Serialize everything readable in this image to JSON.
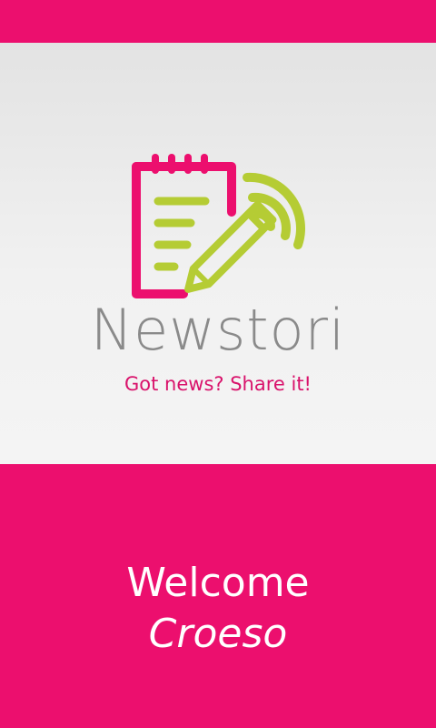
{
  "app": {
    "name": "Newstori",
    "tagline": "Got news? Share it!"
  },
  "welcome": {
    "text": "Welcome",
    "subtext": "Croeso"
  },
  "colors": {
    "accent": "#ec0f6e",
    "tagline": "#d9126b",
    "logo_green": "#b5cc34",
    "logo_pink": "#ec0f6e",
    "app_name": "#8a8a8a",
    "hero_bg": "#ececec"
  },
  "icons": {
    "logo": "notepad-pencil-signal-icon"
  }
}
